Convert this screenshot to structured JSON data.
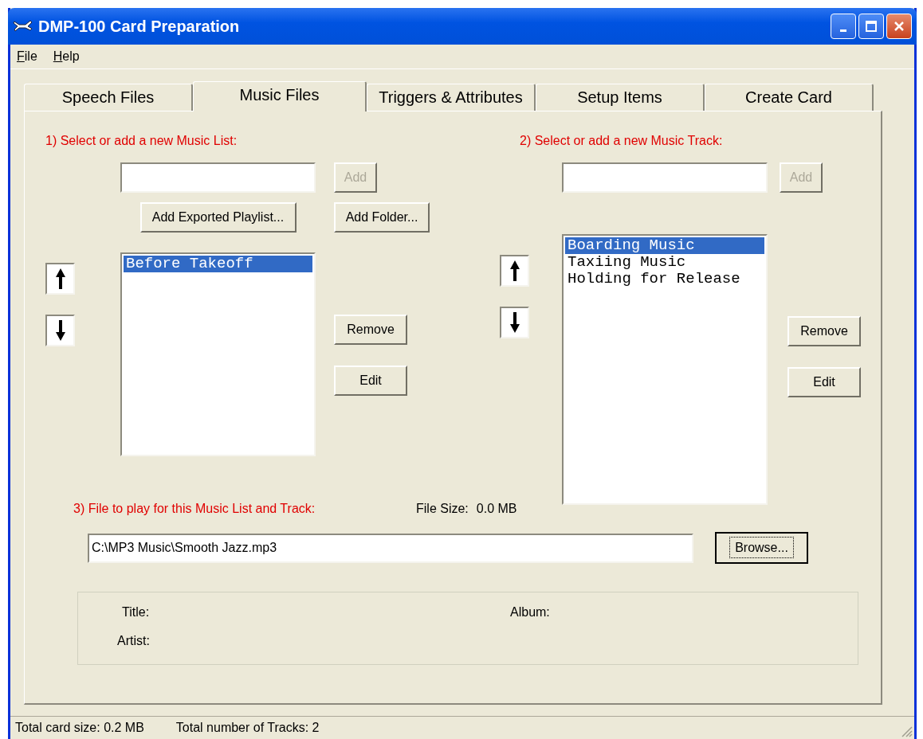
{
  "window": {
    "title": "DMP-100 Card Preparation"
  },
  "menu": [
    {
      "label": "File"
    },
    {
      "label": "Help"
    }
  ],
  "tabs": [
    {
      "label": "Speech Files",
      "selected": false
    },
    {
      "label": "Music Files",
      "selected": true
    },
    {
      "label": "Triggers & Attributes",
      "selected": false
    },
    {
      "label": "Setup Items",
      "selected": false
    },
    {
      "label": "Create Card",
      "selected": false
    }
  ],
  "music_list": {
    "label": "1) Select or add a new Music List:",
    "add_button": {
      "label": "Add",
      "disabled": true
    },
    "playlist_button": "Add Exported Playlist...",
    "folder_button": "Add Folder...",
    "items": [
      {
        "text": "Before Takeoff",
        "selected": true
      }
    ],
    "remove_button": "Remove",
    "edit_button": "Edit"
  },
  "music_track": {
    "label": "2) Select or add a new Music Track:",
    "add_button": {
      "label": "Add",
      "disabled": true
    },
    "items": [
      {
        "text": "Boarding Music",
        "selected": true
      },
      {
        "text": "Taxiing Music",
        "selected": false
      },
      {
        "text": "Holding for Release",
        "selected": false
      }
    ],
    "remove_button": "Remove",
    "edit_button": "Edit"
  },
  "file": {
    "label": "3) File to play for this Music List and Track:",
    "size_label": "File Size:",
    "size_value": "0.0 MB",
    "path": "C:\\MP3 Music\\Smooth Jazz.mp3",
    "browse_button": {
      "label": "Browse...",
      "focused": true
    }
  },
  "tag_info": {
    "title_label": "Title:",
    "album_label": "Album:",
    "artist_label": "Artist:"
  },
  "status_bar": [
    "Total card size: 0.2 MB",
    "Total number of Tracks: 2"
  ]
}
